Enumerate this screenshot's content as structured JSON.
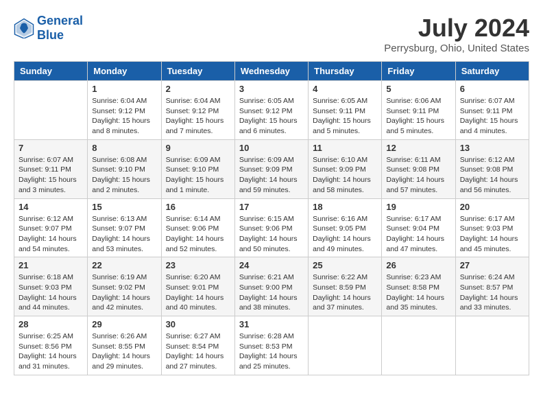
{
  "header": {
    "logo_line1": "General",
    "logo_line2": "Blue",
    "month_year": "July 2024",
    "location": "Perrysburg, Ohio, United States"
  },
  "days_of_week": [
    "Sunday",
    "Monday",
    "Tuesday",
    "Wednesday",
    "Thursday",
    "Friday",
    "Saturday"
  ],
  "weeks": [
    [
      {
        "day": "",
        "sunrise": "",
        "sunset": "",
        "daylight": ""
      },
      {
        "day": "1",
        "sunrise": "Sunrise: 6:04 AM",
        "sunset": "Sunset: 9:12 PM",
        "daylight": "Daylight: 15 hours and 8 minutes."
      },
      {
        "day": "2",
        "sunrise": "Sunrise: 6:04 AM",
        "sunset": "Sunset: 9:12 PM",
        "daylight": "Daylight: 15 hours and 7 minutes."
      },
      {
        "day": "3",
        "sunrise": "Sunrise: 6:05 AM",
        "sunset": "Sunset: 9:12 PM",
        "daylight": "Daylight: 15 hours and 6 minutes."
      },
      {
        "day": "4",
        "sunrise": "Sunrise: 6:05 AM",
        "sunset": "Sunset: 9:11 PM",
        "daylight": "Daylight: 15 hours and 5 minutes."
      },
      {
        "day": "5",
        "sunrise": "Sunrise: 6:06 AM",
        "sunset": "Sunset: 9:11 PM",
        "daylight": "Daylight: 15 hours and 5 minutes."
      },
      {
        "day": "6",
        "sunrise": "Sunrise: 6:07 AM",
        "sunset": "Sunset: 9:11 PM",
        "daylight": "Daylight: 15 hours and 4 minutes."
      }
    ],
    [
      {
        "day": "7",
        "sunrise": "Sunrise: 6:07 AM",
        "sunset": "Sunset: 9:11 PM",
        "daylight": "Daylight: 15 hours and 3 minutes."
      },
      {
        "day": "8",
        "sunrise": "Sunrise: 6:08 AM",
        "sunset": "Sunset: 9:10 PM",
        "daylight": "Daylight: 15 hours and 2 minutes."
      },
      {
        "day": "9",
        "sunrise": "Sunrise: 6:09 AM",
        "sunset": "Sunset: 9:10 PM",
        "daylight": "Daylight: 15 hours and 1 minute."
      },
      {
        "day": "10",
        "sunrise": "Sunrise: 6:09 AM",
        "sunset": "Sunset: 9:09 PM",
        "daylight": "Daylight: 14 hours and 59 minutes."
      },
      {
        "day": "11",
        "sunrise": "Sunrise: 6:10 AM",
        "sunset": "Sunset: 9:09 PM",
        "daylight": "Daylight: 14 hours and 58 minutes."
      },
      {
        "day": "12",
        "sunrise": "Sunrise: 6:11 AM",
        "sunset": "Sunset: 9:08 PM",
        "daylight": "Daylight: 14 hours and 57 minutes."
      },
      {
        "day": "13",
        "sunrise": "Sunrise: 6:12 AM",
        "sunset": "Sunset: 9:08 PM",
        "daylight": "Daylight: 14 hours and 56 minutes."
      }
    ],
    [
      {
        "day": "14",
        "sunrise": "Sunrise: 6:12 AM",
        "sunset": "Sunset: 9:07 PM",
        "daylight": "Daylight: 14 hours and 54 minutes."
      },
      {
        "day": "15",
        "sunrise": "Sunrise: 6:13 AM",
        "sunset": "Sunset: 9:07 PM",
        "daylight": "Daylight: 14 hours and 53 minutes."
      },
      {
        "day": "16",
        "sunrise": "Sunrise: 6:14 AM",
        "sunset": "Sunset: 9:06 PM",
        "daylight": "Daylight: 14 hours and 52 minutes."
      },
      {
        "day": "17",
        "sunrise": "Sunrise: 6:15 AM",
        "sunset": "Sunset: 9:06 PM",
        "daylight": "Daylight: 14 hours and 50 minutes."
      },
      {
        "day": "18",
        "sunrise": "Sunrise: 6:16 AM",
        "sunset": "Sunset: 9:05 PM",
        "daylight": "Daylight: 14 hours and 49 minutes."
      },
      {
        "day": "19",
        "sunrise": "Sunrise: 6:17 AM",
        "sunset": "Sunset: 9:04 PM",
        "daylight": "Daylight: 14 hours and 47 minutes."
      },
      {
        "day": "20",
        "sunrise": "Sunrise: 6:17 AM",
        "sunset": "Sunset: 9:03 PM",
        "daylight": "Daylight: 14 hours and 45 minutes."
      }
    ],
    [
      {
        "day": "21",
        "sunrise": "Sunrise: 6:18 AM",
        "sunset": "Sunset: 9:03 PM",
        "daylight": "Daylight: 14 hours and 44 minutes."
      },
      {
        "day": "22",
        "sunrise": "Sunrise: 6:19 AM",
        "sunset": "Sunset: 9:02 PM",
        "daylight": "Daylight: 14 hours and 42 minutes."
      },
      {
        "day": "23",
        "sunrise": "Sunrise: 6:20 AM",
        "sunset": "Sunset: 9:01 PM",
        "daylight": "Daylight: 14 hours and 40 minutes."
      },
      {
        "day": "24",
        "sunrise": "Sunrise: 6:21 AM",
        "sunset": "Sunset: 9:00 PM",
        "daylight": "Daylight: 14 hours and 38 minutes."
      },
      {
        "day": "25",
        "sunrise": "Sunrise: 6:22 AM",
        "sunset": "Sunset: 8:59 PM",
        "daylight": "Daylight: 14 hours and 37 minutes."
      },
      {
        "day": "26",
        "sunrise": "Sunrise: 6:23 AM",
        "sunset": "Sunset: 8:58 PM",
        "daylight": "Daylight: 14 hours and 35 minutes."
      },
      {
        "day": "27",
        "sunrise": "Sunrise: 6:24 AM",
        "sunset": "Sunset: 8:57 PM",
        "daylight": "Daylight: 14 hours and 33 minutes."
      }
    ],
    [
      {
        "day": "28",
        "sunrise": "Sunrise: 6:25 AM",
        "sunset": "Sunset: 8:56 PM",
        "daylight": "Daylight: 14 hours and 31 minutes."
      },
      {
        "day": "29",
        "sunrise": "Sunrise: 6:26 AM",
        "sunset": "Sunset: 8:55 PM",
        "daylight": "Daylight: 14 hours and 29 minutes."
      },
      {
        "day": "30",
        "sunrise": "Sunrise: 6:27 AM",
        "sunset": "Sunset: 8:54 PM",
        "daylight": "Daylight: 14 hours and 27 minutes."
      },
      {
        "day": "31",
        "sunrise": "Sunrise: 6:28 AM",
        "sunset": "Sunset: 8:53 PM",
        "daylight": "Daylight: 14 hours and 25 minutes."
      },
      {
        "day": "",
        "sunrise": "",
        "sunset": "",
        "daylight": ""
      },
      {
        "day": "",
        "sunrise": "",
        "sunset": "",
        "daylight": ""
      },
      {
        "day": "",
        "sunrise": "",
        "sunset": "",
        "daylight": ""
      }
    ]
  ]
}
